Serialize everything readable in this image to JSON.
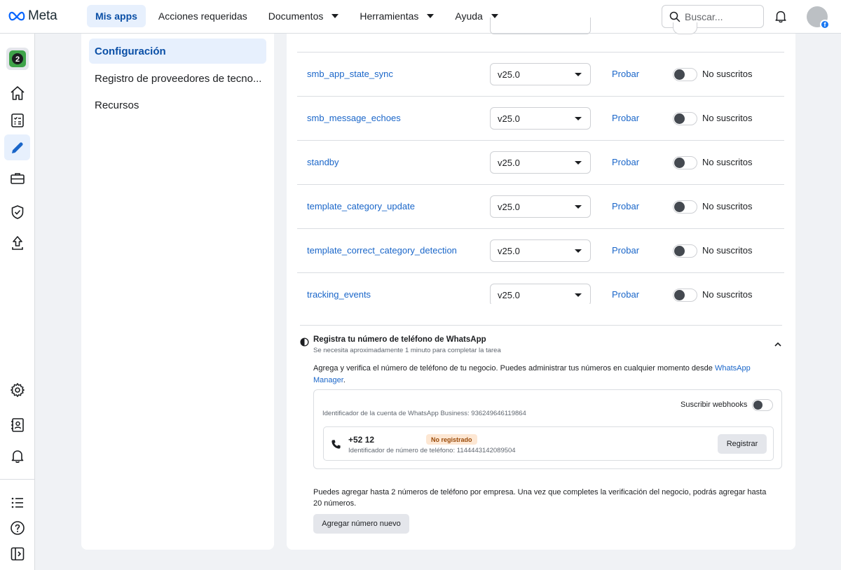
{
  "header": {
    "brand": "Meta",
    "nav": [
      {
        "label": "Mis apps",
        "active": true,
        "dropdown": false
      },
      {
        "label": "Acciones requeridas",
        "active": false,
        "dropdown": false
      },
      {
        "label": "Documentos",
        "active": false,
        "dropdown": true
      },
      {
        "label": "Herramientas",
        "active": false,
        "dropdown": true
      },
      {
        "label": "Ayuda",
        "active": false,
        "dropdown": true
      }
    ],
    "search_placeholder": "Buscar...",
    "avatar_badge": "f"
  },
  "rail": {
    "app_badge": "2",
    "icons": [
      "home-icon",
      "checklist-icon",
      "pencil-icon",
      "briefcase-icon",
      "shield-check-icon",
      "upload-icon",
      "gear-icon",
      "contact-card-icon",
      "bell-icon",
      "list-icon",
      "help-icon",
      "collapse-panel-icon"
    ],
    "active_icon": "pencil-icon",
    "accent": "#1a66c9"
  },
  "sidebar": {
    "items": [
      {
        "label": "Configuración",
        "active": true
      },
      {
        "label": "Registro de proveedores de tecno..."
      },
      {
        "label": "Recursos"
      }
    ]
  },
  "webhooks": {
    "rows": [
      {
        "name": "smb_app_state_sync",
        "version": "v25.0",
        "action": "Probar",
        "status": "No suscritos"
      },
      {
        "name": "smb_message_echoes",
        "version": "v25.0",
        "action": "Probar",
        "status": "No suscritos"
      },
      {
        "name": "standby",
        "version": "v25.0",
        "action": "Probar",
        "status": "No suscritos"
      },
      {
        "name": "template_category_update",
        "version": "v25.0",
        "action": "Probar",
        "status": "No suscritos"
      },
      {
        "name": "template_correct_category_detection",
        "version": "v25.0",
        "action": "Probar",
        "status": "No suscritos"
      },
      {
        "name": "tracking_events",
        "version": "v25.0",
        "action": "Probar",
        "status": "No suscritos"
      }
    ]
  },
  "register": {
    "title": "Registra tu número de teléfono de WhatsApp",
    "subtitle": "Se necesita aproximadamente 1 minuto para completar la tarea",
    "description": "Agrega y verifica el número de teléfono de tu negocio. Puedes administrar tus números en cualquier momento desde ",
    "description_link": "WhatsApp Manager",
    "description_end": ".",
    "account_id": "Identificador de la cuenta de WhatsApp Business: 936249646119864",
    "subscribe_label": "Suscribir webhooks",
    "phone": {
      "number": "+52 12",
      "badge": "No registrado",
      "phone_id": "Identificador de número de teléfono: 1144443142089504",
      "button": "Registrar"
    },
    "note": "Puedes agregar hasta 2 números de teléfono por empresa. Una vez que completes la verificación del negocio, podrás agregar hasta 20 números.",
    "add_button": "Agregar número nuevo"
  }
}
